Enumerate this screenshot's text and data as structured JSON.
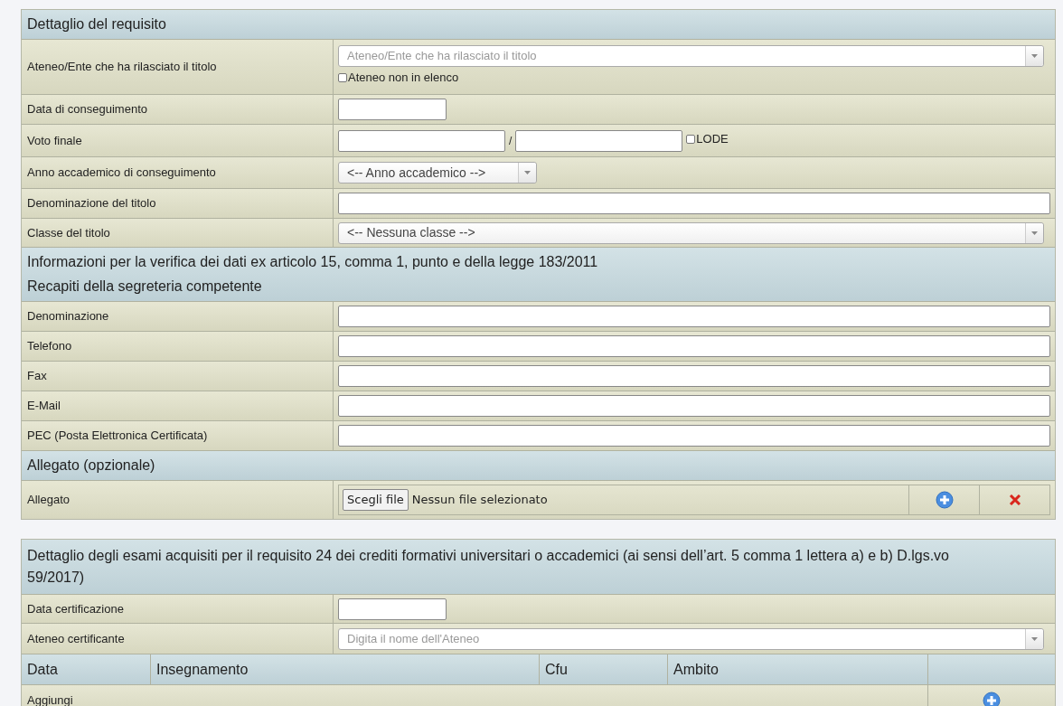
{
  "requirement_table": {
    "sections": [
      {
        "title": "Dettaglio del requisito",
        "rows": [
          {
            "label": "Ateneo/Ente che ha rilasciato il titolo",
            "kind": "combo",
            "placeholder": "Ateneo/Ente che ha rilasciato il titolo",
            "checkbox": {
              "label": "Ateneo non in elenco",
              "checked": false
            }
          },
          {
            "label": "Data di conseguimento",
            "kind": "short"
          },
          {
            "label": "Voto finale",
            "kind": "grade",
            "separator": "/",
            "checkbox": {
              "label": "LODE",
              "checked": false
            }
          },
          {
            "label": "Anno accademico di conseguimento",
            "kind": "small_select",
            "value": "<-- Anno accademico -->"
          },
          {
            "label": "Denominazione del titolo",
            "kind": "text"
          },
          {
            "label": "Classe del titolo",
            "kind": "select",
            "value": "<-- Nessuna classe -->"
          }
        ]
      },
      {
        "title": "Informazioni per la verifica dei dati ex articolo 15, comma 1, punto e della legge 183/2011",
        "subtitle": "Recapiti della segreteria competente",
        "rows": [
          {
            "label": "Denominazione",
            "kind": "text"
          },
          {
            "label": "Telefono",
            "kind": "text"
          },
          {
            "label": "Fax",
            "kind": "text"
          },
          {
            "label": "E-Mail",
            "kind": "text"
          },
          {
            "label": "PEC (Posta Elettronica Certificata)",
            "kind": "text"
          }
        ]
      },
      {
        "title": "Allegato (opzionale)",
        "rows": [
          {
            "label": "Allegato",
            "kind": "file",
            "button": "Scegli file",
            "status": "Nessun file selezionato"
          }
        ]
      }
    ]
  },
  "exams_table": {
    "title": "Dettaglio degli esami acquisiti per il requisito 24 dei crediti formativi universitari o accademici (ai sensi dell’art. 5 comma 1 lettera a) e b) D.lgs.vo 59/2017)",
    "rows": [
      {
        "label": "Data certificazione",
        "kind": "short"
      },
      {
        "label": "Ateneo certificante",
        "kind": "combo",
        "placeholder": "Digita il nome dell'Ateneo"
      }
    ],
    "columns": [
      "Data",
      "Insegnamento",
      "Cfu",
      "Ambito"
    ],
    "add_row": {
      "label": "Aggiungi"
    }
  }
}
